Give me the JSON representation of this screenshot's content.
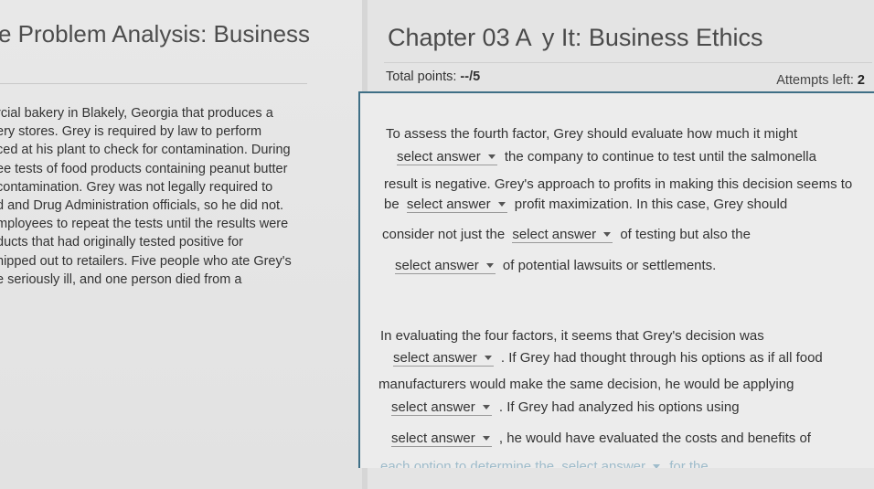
{
  "left": {
    "title": "e Problem Analysis: Business",
    "lines": [
      "rcial bakery in Blakely, Georgia that produces a",
      "ery stores. Grey is required by law to perform",
      "ced at his plant to check for contamination. During",
      "ee tests of food products containing peanut butter",
      "contamination. Grey was not legally required to",
      "d and Drug Administration officials, so he did not.",
      "mployees to repeat the tests until the results were",
      "ducts that had originally tested positive for",
      "hipped out to retailers. Five people who ate Grey's",
      "e seriously ill, and one person died from a"
    ]
  },
  "right": {
    "title": "Chapter 03 A     y It: Business Ethics",
    "points_label": "Total points:",
    "points_value": "--/5",
    "attempts_label": "Attempts left:",
    "attempts_value": "2"
  },
  "question": {
    "select_label": "select answer",
    "p1": [
      "To assess the fourth factor, Grey should evaluate how much it might",
      "the company to continue to test until the salmonella",
      "result is negative. Grey's approach to profits in making this decision seems to",
      "be",
      "profit maximization. In this case, Grey should",
      "consider not just the",
      "of testing but also the",
      "of potential lawsuits or settlements."
    ],
    "p2": [
      "In evaluating the four factors, it seems that Grey's decision was",
      ". If Grey had thought through his options as if all food",
      "manufacturers would make the same decision, he would be applying",
      ". If Grey had analyzed his options using",
      ", he would have evaluated the costs and benefits of",
      "each option to determine the",
      "for the"
    ]
  }
}
